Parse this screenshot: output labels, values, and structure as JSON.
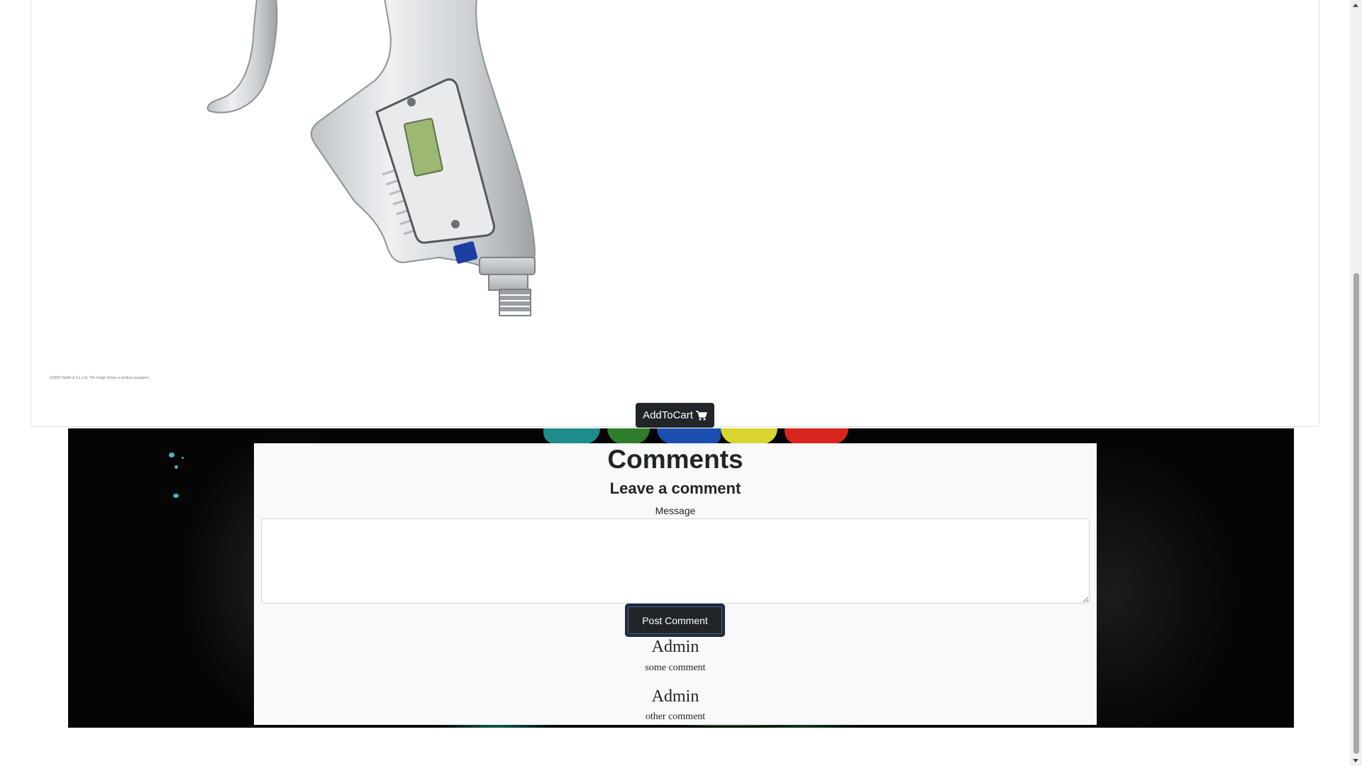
{
  "product": {
    "image_alt": "digital spray gun",
    "fineprint": "©1999 Datdin & Co. Ltd. The image shows a product equipped...",
    "add_to_cart_label": "AddToCart",
    "cart_icon": "cart-icon"
  },
  "comments": {
    "title": "Comments",
    "leave_title": "Leave a comment",
    "message_label": "Message",
    "message_value": "",
    "post_label": "Post Comment",
    "items": [
      {
        "author": "Admin",
        "text": "some comment"
      },
      {
        "author": "Admin",
        "text": "other comment"
      }
    ]
  },
  "colors": {
    "button_dark": "#212529",
    "panel_bg": "#f8f9fa",
    "banner_bg": "#050505"
  }
}
